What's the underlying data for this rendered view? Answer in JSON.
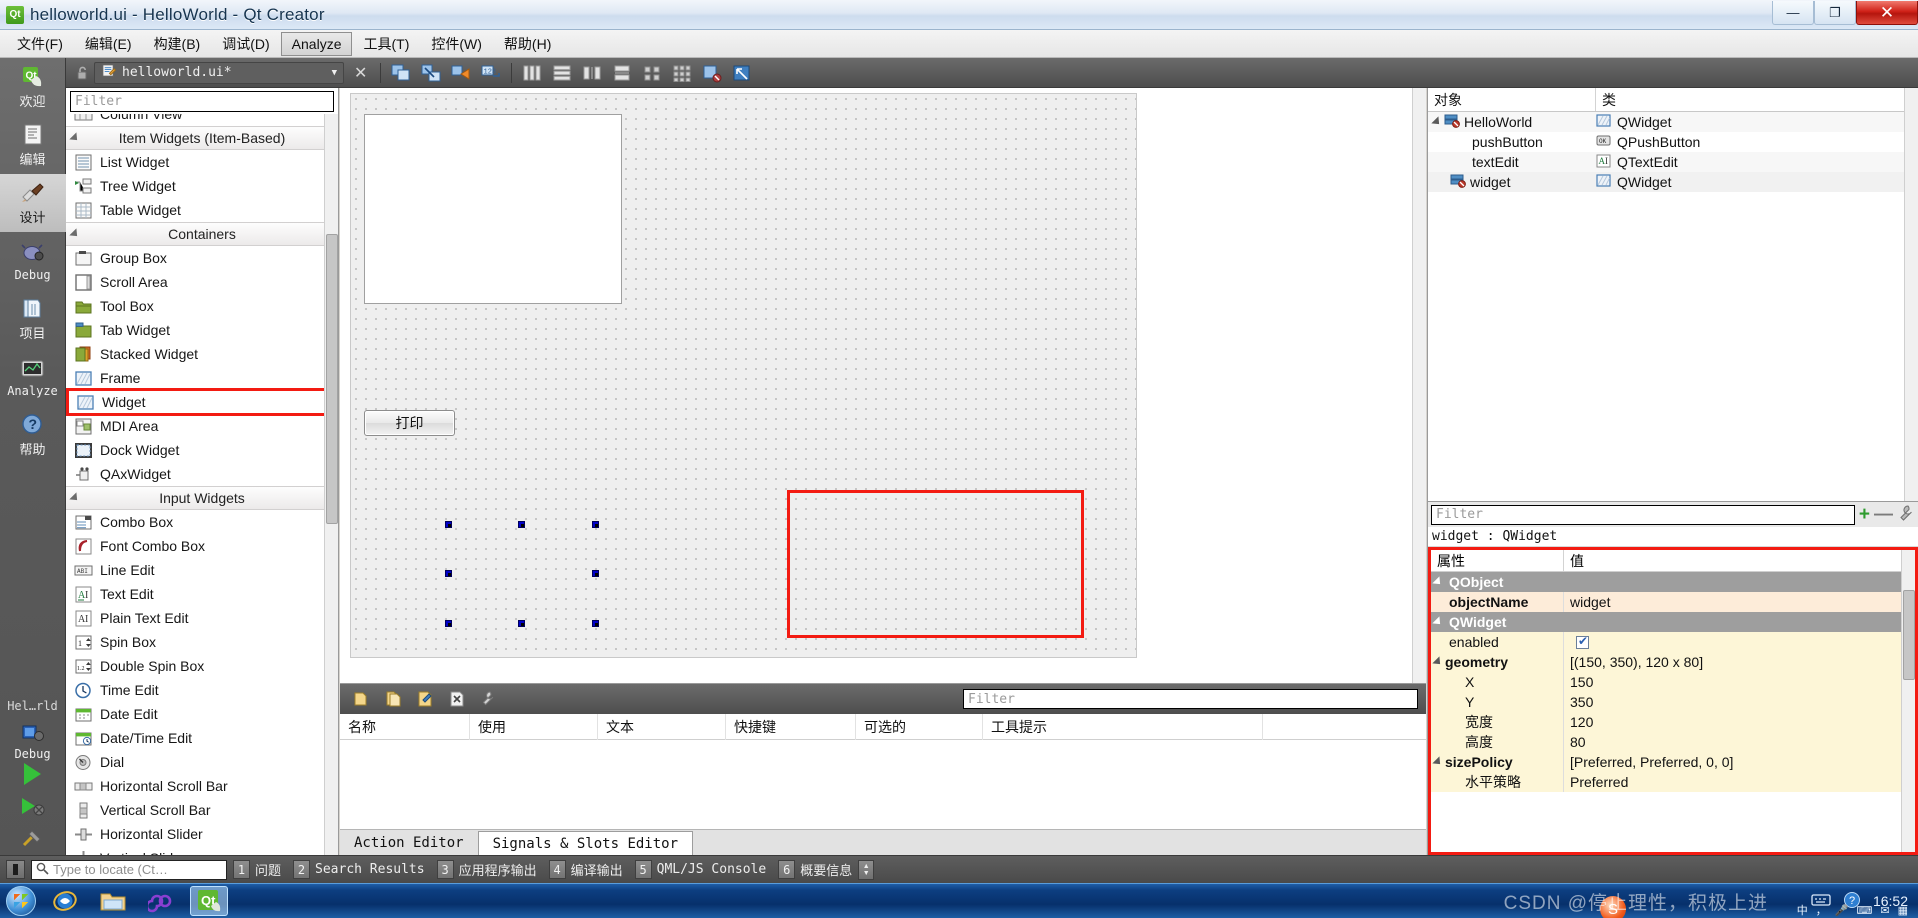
{
  "window": {
    "title": "helloworld.ui - HelloWorld - Qt Creator",
    "app_icon": "qt-icon",
    "minimize": "—",
    "maximize": "❐",
    "close": "✕"
  },
  "menubar": {
    "items": [
      {
        "label": "文件(F)",
        "active": false
      },
      {
        "label": "编辑(E)",
        "active": false
      },
      {
        "label": "构建(B)",
        "active": false
      },
      {
        "label": "调试(D)",
        "active": false
      },
      {
        "label": "Analyze",
        "active": true
      },
      {
        "label": "工具(T)",
        "active": false
      },
      {
        "label": "控件(W)",
        "active": false
      },
      {
        "label": "帮助(H)",
        "active": false
      }
    ]
  },
  "modebar": {
    "items": [
      {
        "label": "欢迎",
        "icon": "qt-welcome-icon",
        "selected": false
      },
      {
        "label": "编辑",
        "icon": "edit-document-icon",
        "selected": false
      },
      {
        "label": "设计",
        "icon": "design-brush-icon",
        "selected": true
      },
      {
        "label": "Debug",
        "icon": "debug-bug-icon",
        "selected": false
      },
      {
        "label": "项目",
        "icon": "projects-folder-icon",
        "selected": false
      },
      {
        "label": "Analyze",
        "icon": "analyze-monitor-icon",
        "selected": false
      },
      {
        "label": "帮助",
        "icon": "help-question-icon",
        "selected": false
      }
    ],
    "project_label": "Hel…rld",
    "run_config": "Debug",
    "run_button": "run-icon",
    "debug_button": "debug-run-icon",
    "build_button": "build-hammer-icon"
  },
  "editor_toolbar": {
    "lock_icon": "lock-open-icon",
    "file_icon": "ui-file-icon",
    "filename": "helloworld.ui*",
    "dropdown_caret": "▼",
    "close_icon": "✕",
    "tools": [
      "edit-widgets-icon",
      "edit-signals-slots-icon",
      "edit-buddies-icon",
      "edit-tab-order-icon",
      "layout-horizontal-icon",
      "layout-vertical-icon",
      "layout-splitter-h-icon",
      "layout-splitter-v-icon",
      "layout-form-icon",
      "layout-grid-icon",
      "break-layout-icon",
      "adjust-size-icon"
    ]
  },
  "widgetbox": {
    "filter_placeholder": "Filter",
    "items": [
      {
        "type": "item",
        "label": "Column View",
        "icon": "column-view-icon",
        "clipped": true
      },
      {
        "type": "category",
        "label": "Item Widgets (Item-Based)"
      },
      {
        "type": "item",
        "label": "List Widget",
        "icon": "list-widget-icon"
      },
      {
        "type": "item",
        "label": "Tree Widget",
        "icon": "tree-widget-icon"
      },
      {
        "type": "item",
        "label": "Table Widget",
        "icon": "table-widget-icon"
      },
      {
        "type": "category",
        "label": "Containers"
      },
      {
        "type": "item",
        "label": "Group Box",
        "icon": "group-box-icon"
      },
      {
        "type": "item",
        "label": "Scroll Area",
        "icon": "scroll-area-icon"
      },
      {
        "type": "item",
        "label": "Tool Box",
        "icon": "tool-box-icon"
      },
      {
        "type": "item",
        "label": "Tab Widget",
        "icon": "tab-widget-icon"
      },
      {
        "type": "item",
        "label": "Stacked Widget",
        "icon": "stacked-widget-icon"
      },
      {
        "type": "item",
        "label": "Frame",
        "icon": "frame-icon"
      },
      {
        "type": "item",
        "label": "Widget",
        "icon": "widget-icon",
        "highlight": true
      },
      {
        "type": "item",
        "label": "MDI Area",
        "icon": "mdi-area-icon"
      },
      {
        "type": "item",
        "label": "Dock Widget",
        "icon": "dock-widget-icon"
      },
      {
        "type": "item",
        "label": "QAxWidget",
        "icon": "qax-widget-icon"
      },
      {
        "type": "category",
        "label": "Input Widgets"
      },
      {
        "type": "item",
        "label": "Combo Box",
        "icon": "combo-box-icon"
      },
      {
        "type": "item",
        "label": "Font Combo Box",
        "icon": "font-combo-box-icon"
      },
      {
        "type": "item",
        "label": "Line Edit",
        "icon": "line-edit-icon"
      },
      {
        "type": "item",
        "label": "Text Edit",
        "icon": "text-edit-icon"
      },
      {
        "type": "item",
        "label": "Plain Text Edit",
        "icon": "plain-text-edit-icon"
      },
      {
        "type": "item",
        "label": "Spin Box",
        "icon": "spin-box-icon"
      },
      {
        "type": "item",
        "label": "Double Spin Box",
        "icon": "double-spin-box-icon"
      },
      {
        "type": "item",
        "label": "Time Edit",
        "icon": "time-edit-icon"
      },
      {
        "type": "item",
        "label": "Date Edit",
        "icon": "date-edit-icon"
      },
      {
        "type": "item",
        "label": "Date/Time Edit",
        "icon": "date-time-edit-icon"
      },
      {
        "type": "item",
        "label": "Dial",
        "icon": "dial-icon"
      },
      {
        "type": "item",
        "label": "Horizontal Scroll Bar",
        "icon": "h-scrollbar-icon"
      },
      {
        "type": "item",
        "label": "Vertical Scroll Bar",
        "icon": "v-scrollbar-icon"
      },
      {
        "type": "item",
        "label": "Horizontal Slider",
        "icon": "h-slider-icon"
      },
      {
        "type": "item",
        "label": "Vertical Slider",
        "icon": "v-slider-icon",
        "clipped": true
      }
    ]
  },
  "canvas": {
    "textedit_name": "textEdit",
    "pushbutton_label": "打印",
    "selected_widget": "widget",
    "annotation_color": "#f31b12"
  },
  "object_inspector": {
    "columns": [
      "对象",
      "类"
    ],
    "rows": [
      {
        "name": "HelloWorld",
        "class": "QWidget",
        "icon": "form-icon",
        "class_icon": "qwidget-icon",
        "indent": 0,
        "expanded": true
      },
      {
        "name": "pushButton",
        "class": "QPushButton",
        "icon": "",
        "class_icon": "qpushbutton-icon",
        "indent": 1
      },
      {
        "name": "textEdit",
        "class": "QTextEdit",
        "icon": "",
        "class_icon": "qtextedit-icon",
        "indent": 1
      },
      {
        "name": "widget",
        "class": "QWidget",
        "icon": "form-icon",
        "class_icon": "qwidget-icon",
        "indent": 1,
        "selected": true
      }
    ]
  },
  "property_editor": {
    "filter_placeholder": "Filter",
    "add_icon": "+",
    "remove_icon": "—",
    "configure_icon": "wrench-icon",
    "object_line": "widget : QWidget",
    "columns": [
      "属性",
      "值"
    ],
    "rows": [
      {
        "kind": "group",
        "name": "QObject",
        "value": ""
      },
      {
        "kind": "prop",
        "name": "objectName",
        "value": "widget",
        "style": "peach",
        "bold": true
      },
      {
        "kind": "group",
        "name": "QWidget",
        "value": ""
      },
      {
        "kind": "prop",
        "name": "enabled",
        "value": "",
        "style": "cream",
        "checkbox": true
      },
      {
        "kind": "prop-expand",
        "name": "geometry",
        "value": "[(150, 350), 120 x 80]",
        "style": "cream",
        "bold": true
      },
      {
        "kind": "sub",
        "name": "X",
        "value": "150",
        "style": "cream"
      },
      {
        "kind": "sub",
        "name": "Y",
        "value": "350",
        "style": "cream"
      },
      {
        "kind": "sub",
        "name": "宽度",
        "value": "120",
        "style": "cream"
      },
      {
        "kind": "sub",
        "name": "高度",
        "value": "80",
        "style": "cream"
      },
      {
        "kind": "prop-expand",
        "name": "sizePolicy",
        "value": "[Preferred, Preferred, 0, 0]",
        "style": "cream"
      },
      {
        "kind": "sub",
        "name": "水平策略",
        "value": "Preferred",
        "style": "cream"
      }
    ]
  },
  "action_editor": {
    "toolbar_icons": [
      "new-action-icon",
      "copy-action-icon",
      "edit-action-icon",
      "delete-action-icon",
      "view-mode-icon"
    ],
    "filter_placeholder": "Filter",
    "columns": [
      "名称",
      "使用",
      "文本",
      "快捷键",
      "可选的",
      "工具提示"
    ],
    "rows": [],
    "tabs": [
      {
        "label": "Action Editor",
        "active": false
      },
      {
        "label": "Signals & Slots Editor",
        "active": true
      }
    ]
  },
  "statusbar": {
    "sidebar_icon": "sidebar-toggle-icon",
    "locate_placeholder": "Type to locate (Ct…",
    "search_icon": "search-icon",
    "panes": [
      {
        "num": "1",
        "label": "问题",
        "cjk": true
      },
      {
        "num": "2",
        "label": "Search Results",
        "cjk": false
      },
      {
        "num": "3",
        "label": "应用程序输出",
        "cjk": true
      },
      {
        "num": "4",
        "label": "编译输出",
        "cjk": true
      },
      {
        "num": "5",
        "label": "QML/JS Console",
        "cjk": false
      },
      {
        "num": "6",
        "label": "概要信息",
        "cjk": true
      }
    ]
  },
  "taskbar": {
    "start_icon": "windows-start-orb",
    "apps": [
      {
        "icon": "internet-explorer-icon",
        "active": false
      },
      {
        "icon": "file-explorer-icon",
        "active": false
      },
      {
        "icon": "visual-studio-icon",
        "active": false
      },
      {
        "icon": "qt-creator-icon",
        "active": true
      }
    ],
    "tray": {
      "keyboard_icon": "keyboard-icon",
      "help_icon": "help-icon",
      "ime_sogou_icon": "sogou-ime-icon",
      "time": "16:52"
    },
    "watermark": "CSDN @停止理性，积极上进"
  }
}
